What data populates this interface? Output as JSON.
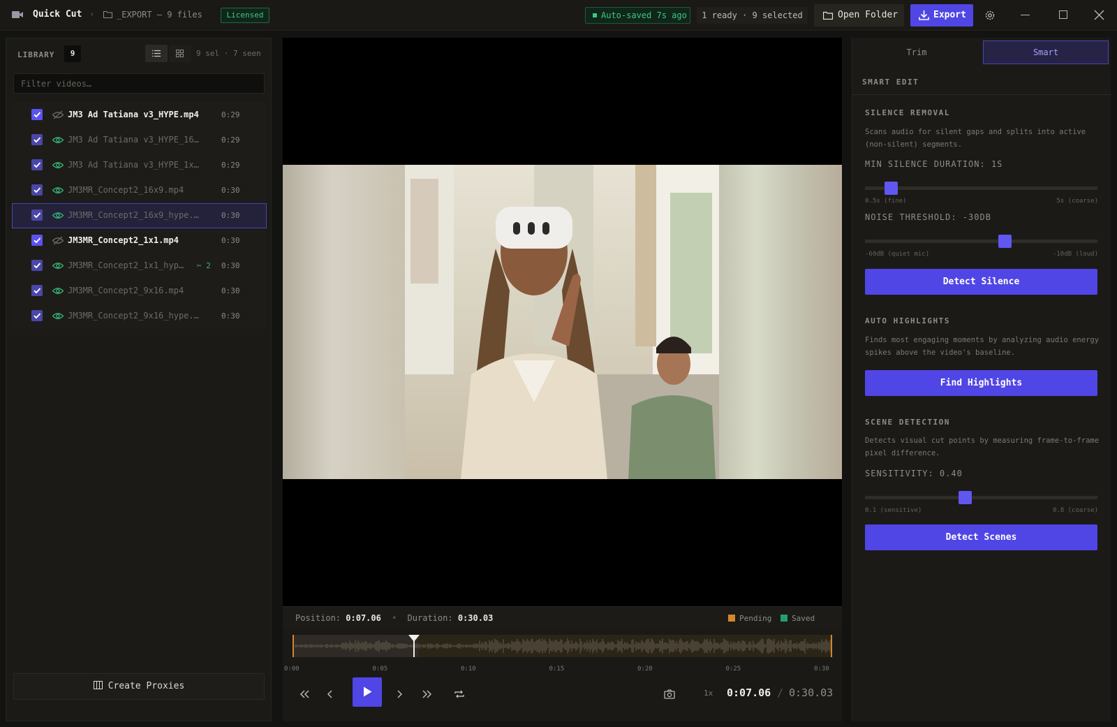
{
  "app": {
    "title": "Quick Cut",
    "breadcrumb_sep": "›",
    "folder_path": "_EXPORT — 9 files",
    "license_badge": "Licensed",
    "autosave_status": "Auto-saved 7s ago",
    "selection_status": "1 ready · 9 selected",
    "open_folder_label": "Open Folder",
    "export_label": "Export",
    "accent_color": "#5046e5",
    "icons": [
      "video-icon",
      "folder-icon",
      "settings-icon",
      "minimize-icon",
      "maximize-icon",
      "close-icon"
    ]
  },
  "library": {
    "title": "LIBRARY",
    "count": "9",
    "meta": "9 sel · 7 seen",
    "filter_placeholder": "Filter videos…",
    "files": [
      {
        "name": "JM3 Ad Tatiana v3_HYPE.mp4",
        "duration": "0:29",
        "active": true,
        "seen": false,
        "selected": false,
        "cuts": ""
      },
      {
        "name": "JM3 Ad Tatiana v3_HYPE_16…",
        "duration": "0:29",
        "active": false,
        "seen": true,
        "selected": false,
        "cuts": ""
      },
      {
        "name": "JM3 Ad Tatiana v3_HYPE_1x…",
        "duration": "0:29",
        "active": false,
        "seen": true,
        "selected": false,
        "cuts": ""
      },
      {
        "name": "JM3MR_Concept2_16x9.mp4",
        "duration": "0:30",
        "active": false,
        "seen": true,
        "selected": false,
        "cuts": ""
      },
      {
        "name": "JM3MR_Concept2_16x9_hype.…",
        "duration": "0:30",
        "active": false,
        "seen": true,
        "selected": true,
        "cuts": ""
      },
      {
        "name": "JM3MR_Concept2_1x1.mp4",
        "duration": "0:30",
        "active": true,
        "seen": false,
        "selected": false,
        "cuts": ""
      },
      {
        "name": "JM3MR_Concept2_1x1_hyp…",
        "duration": "0:30",
        "active": false,
        "seen": true,
        "selected": false,
        "cuts": "✂ 2"
      },
      {
        "name": "JM3MR_Concept2_9x16.mp4",
        "duration": "0:30",
        "active": false,
        "seen": true,
        "selected": false,
        "cuts": ""
      },
      {
        "name": "JM3MR_Concept2_9x16_hype.…",
        "duration": "0:30",
        "active": false,
        "seen": true,
        "selected": false,
        "cuts": ""
      }
    ],
    "create_proxies_label": "Create Proxies"
  },
  "player": {
    "position_label": "Position:",
    "position": "0:07.06",
    "duration_label": "Duration:",
    "duration": "0:30.03",
    "legend_pending": "Pending",
    "legend_saved": "Saved",
    "pending_color": "#d4872a",
    "saved_color": "#23a06a",
    "playhead_fraction": 0.235,
    "ticks": [
      "0:00",
      "0:05",
      "0:10",
      "0:15",
      "0:20",
      "0:25",
      "0:30"
    ],
    "speed": "1x",
    "current_time": "0:07.06",
    "time_sep": "/",
    "total_time": "0:30.03"
  },
  "smart": {
    "tab_trim": "Trim",
    "tab_smart": "Smart",
    "header": "SMART EDIT",
    "silence": {
      "title": "SILENCE REMOVAL",
      "desc": "Scans audio for silent gaps and splits into active (non-silent) segments.",
      "min_silence_label": "MIN SILENCE DURATION: 1S",
      "min_silence_value": 1,
      "min_silence_min": 0.5,
      "min_silence_max": 5,
      "min_silence_lo": "0.5s (fine)",
      "min_silence_hi": "5s (coarse)",
      "noise_label": "NOISE THRESHOLD: -30DB",
      "noise_value": -30,
      "noise_min": -60,
      "noise_max": -10,
      "noise_lo": "-60dB (quiet mic)",
      "noise_hi": "-10dB (loud)",
      "button": "Detect Silence"
    },
    "highlights": {
      "title": "AUTO HIGHLIGHTS",
      "desc": "Finds most engaging moments by analyzing audio energy spikes above the video's baseline.",
      "button": "Find Highlights"
    },
    "scenes": {
      "title": "SCENE DETECTION",
      "desc": "Detects visual cut points by measuring frame-to-frame pixel difference.",
      "sensitivity_label": "SENSITIVITY: 0.40",
      "sensitivity_value": 0.4,
      "sensitivity_min": 0.1,
      "sensitivity_max": 0.8,
      "sensitivity_lo": "0.1 (sensitive)",
      "sensitivity_hi": "0.8 (coarse)",
      "button": "Detect Scenes"
    }
  }
}
